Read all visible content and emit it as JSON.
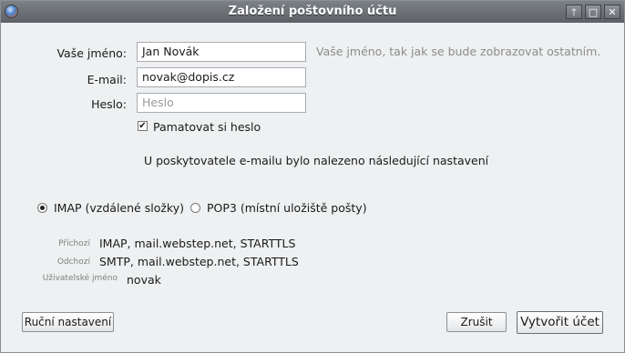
{
  "window": {
    "title": "Založení poštovního účtu",
    "controls": {
      "up": "🡑",
      "maximize": "□",
      "close": "✕"
    }
  },
  "form": {
    "name": {
      "label": "Vaše jméno:",
      "value": "Jan Novák",
      "hint": "Vaše jméno, tak jak se bude zobrazovat ostatním."
    },
    "email": {
      "label": "E-mail:",
      "value": "novak@dopis.cz"
    },
    "password": {
      "label": "Heslo:",
      "placeholder": "Heslo",
      "value": ""
    },
    "remember": {
      "label": "Pamatovat si heslo",
      "checked": true
    }
  },
  "info_text": "U poskytovatele e-mailu bylo nalezeno následující nastavení",
  "protocol": {
    "imap_label": "IMAP (vzdálené složky)",
    "pop3_label": "POP3 (místní uložiště pošty)",
    "selected": "IMAP"
  },
  "settings": {
    "incoming_label": "Příchozí",
    "incoming_value": "IMAP, mail.webstep.net, STARTTLS",
    "outgoing_label": "Odchozí",
    "outgoing_value": "SMTP, mail.webstep.net, STARTTLS",
    "username_label": "Uživatelské jméno",
    "username_value": "novak"
  },
  "buttons": {
    "manual": "Ruční nastavení",
    "cancel": "Zrušit",
    "create": "Vytvořit účet"
  }
}
